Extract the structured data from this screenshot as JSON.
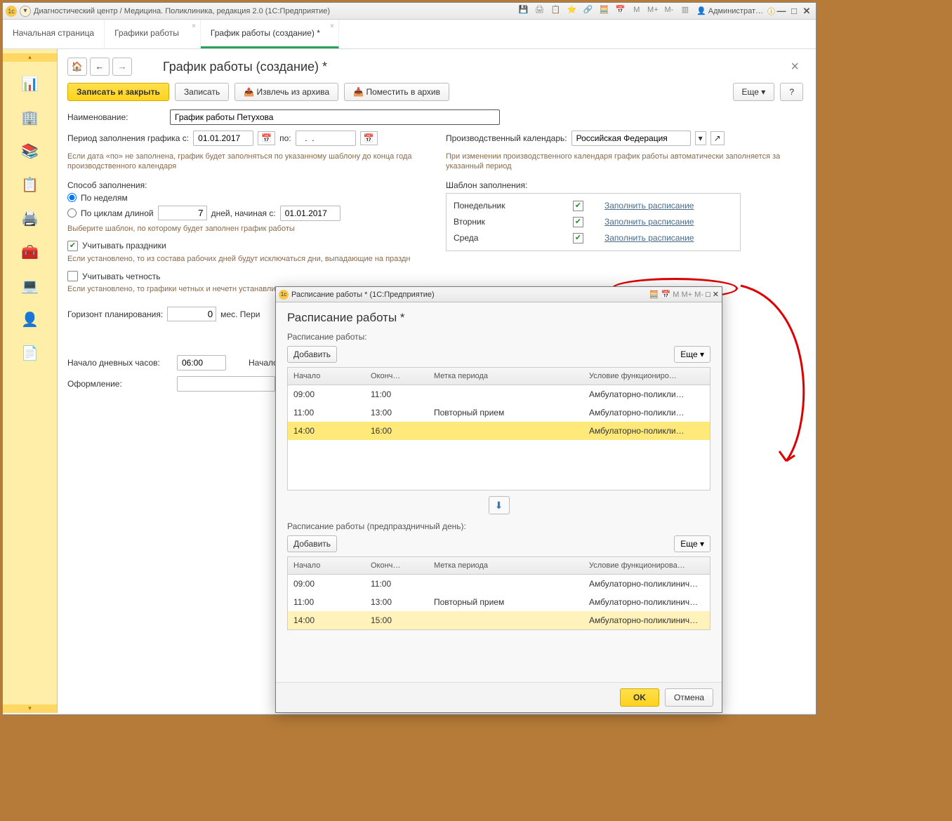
{
  "titlebar": {
    "app_title": "Диагностический центр / Медицина. Поликлиника, редакция 2.0 (1С:Предприятие)",
    "user": "Администрат…"
  },
  "tabs": {
    "t1": "Начальная страница",
    "t2": "Графики работы",
    "t3": "График работы (создание) *"
  },
  "page": {
    "title": "График работы (создание) *",
    "save_close": "Записать и закрыть",
    "save": "Записать",
    "extract": "Извлечь из архива",
    "archive": "Поместить в архив",
    "more": "Еще",
    "help": "?",
    "name_label": "Наименование:",
    "name_value": "График работы Петухова",
    "period_from_lbl": "Период заполнения графика с:",
    "period_from": "01.01.2017",
    "period_to_lbl": "по:",
    "period_to": "  .  .    ",
    "period_hint": "Если дата «по» не заполнена, график будет заполняться по указанному шаблону до конца года производственного календаря",
    "calendar_lbl": "Производственный календарь:",
    "calendar_val": "Российская Федерация",
    "calendar_hint": "При изменении производственного календаря график работы автоматически заполняется за указанный период",
    "fill_method_lbl": "Способ заполнения:",
    "radio_weekly": "По неделям",
    "radio_cycle": "По циклам длиной",
    "cycle_len": "7",
    "cycle_days": "дней,  начиная с:",
    "cycle_start": "01.01.2017",
    "choose_template_hint": "Выберите шаблон, по которому будет заполнен график работы",
    "holidays_check": "Учитывать праздники",
    "holidays_hint": "Если установлено, то из состава рабочих дней будут исключаться дни, выпадающие на праздн",
    "parity_check": "Учитывать четность",
    "parity_hint": "Если установлено, то графики четных и нечетн устанавливаются отдельно",
    "horizon_lbl": "Горизонт планирования:",
    "horizon_val": "0",
    "horizon_unit": "мес. Пери",
    "daystart_lbl": "Начало дневных часов:",
    "daystart_val": "06:00",
    "eveningstart_lbl": "Начало в",
    "design_lbl": "Оформление:",
    "template_lbl": "Шаблон заполнения:",
    "days": {
      "mon": "Понедельник",
      "tue": "Вторник",
      "wed": "Среда"
    },
    "fill_link": "Заполнить расписание"
  },
  "dialog": {
    "wintitle": "Расписание работы * (1С:Предприятие)",
    "title": "Расписание работы *",
    "section1": "Расписание работы:",
    "section2": "Расписание работы (предпраздничный день):",
    "add": "Добавить",
    "more": "Еще",
    "col_start": "Начало",
    "col_end": "Оконч…",
    "col_end2": "Оконч…",
    "col_mark": "Метка периода",
    "col_cond": "Условие функциониро…",
    "col_cond2": "Условие функционирова…",
    "rows1": [
      {
        "start": "09:00",
        "end": "11:00",
        "mark": "",
        "cond": "Амбулаторно-поликли…"
      },
      {
        "start": "11:00",
        "end": "13:00",
        "mark": "Повторный прием",
        "cond": "Амбулаторно-поликли…"
      },
      {
        "start": "14:00",
        "end": "16:00",
        "mark": "",
        "cond": "Амбулаторно-поликли…"
      }
    ],
    "rows2": [
      {
        "start": "09:00",
        "end": "11:00",
        "mark": "",
        "cond": "Амбулаторно-поликлинич…"
      },
      {
        "start": "11:00",
        "end": "13:00",
        "mark": "Повторный прием",
        "cond": "Амбулаторно-поликлинич…"
      },
      {
        "start": "14:00",
        "end": "15:00",
        "mark": "",
        "cond": "Амбулаторно-поликлинич…"
      }
    ],
    "ok": "OK",
    "cancel": "Отмена"
  }
}
